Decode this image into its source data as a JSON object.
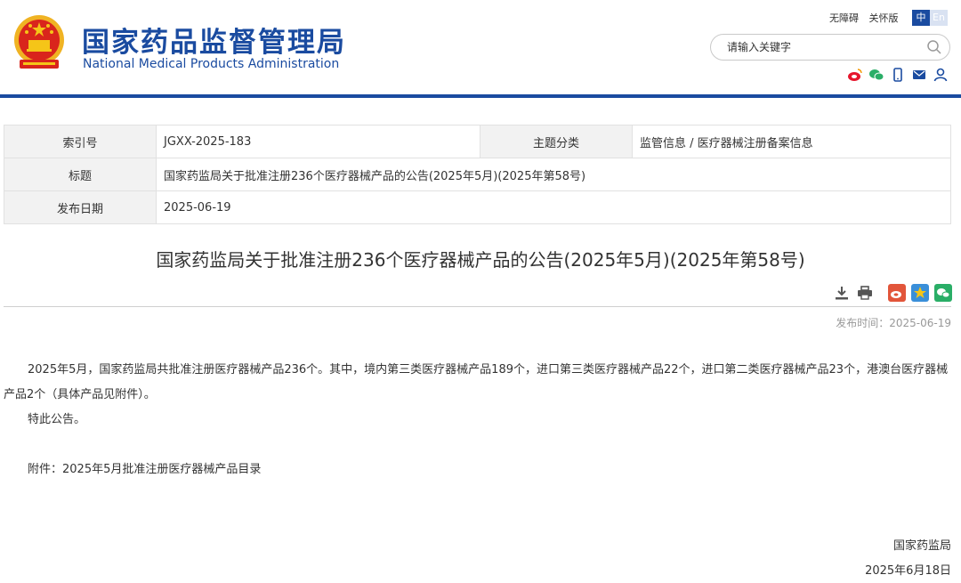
{
  "header": {
    "title_cn": "国家药品监督管理局",
    "title_en": "National Medical Products Administration",
    "links": [
      "无障碍",
      "关怀版"
    ],
    "lang_on": "中",
    "lang_off": "En",
    "search_placeholder": "请输入关键字",
    "social_icons": [
      "weibo-icon",
      "wechat-icon",
      "mobile-icon",
      "mail-icon",
      "user-icon"
    ]
  },
  "meta": {
    "index_label": "索引号",
    "index_value": "JGXX-2025-183",
    "category_label": "主题分类",
    "category_value": "监管信息 / 医疗器械注册备案信息",
    "title_label": "标题",
    "title_value": "国家药监局关于批准注册236个医疗器械产品的公告(2025年5月)(2025年第58号)",
    "date_label": "发布日期",
    "date_value": "2025-06-19"
  },
  "article": {
    "title": "国家药监局关于批准注册236个医疗器械产品的公告(2025年5月)(2025年第58号)",
    "publish_time": "发布时间：2025-06-19",
    "paragraph1": "2025年5月，国家药监局共批准注册医疗器械产品236个。其中，境内第三类医疗器械产品189个，进口第三类医疗器械产品22个，进口第二类医疗器械产品23个，港澳台医疗器械产品2个（具体产品见附件）。",
    "paragraph2": "特此公告。",
    "attachment_prefix": "附件：",
    "attachment_link": "2025年5月批准注册医疗器械产品目录",
    "signature_org": "国家药监局",
    "signature_date": "2025年6月18日"
  },
  "colors": {
    "brand_blue": "#1a4ba0",
    "emblem_red": "#d9251c",
    "emblem_gold": "#f5c518"
  }
}
